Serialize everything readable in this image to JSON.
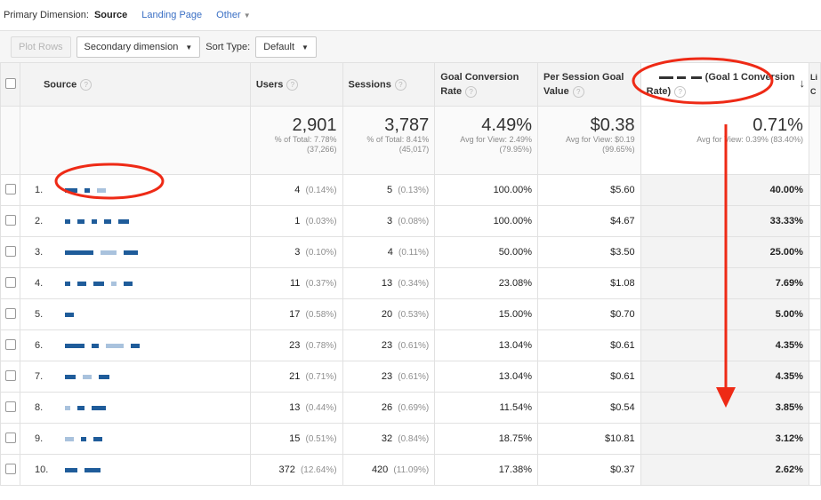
{
  "primary": {
    "label": "Primary Dimension:",
    "active": "Source",
    "options": [
      "Landing Page",
      "Other"
    ]
  },
  "toolbar": {
    "plot_rows": "Plot Rows",
    "secondary": "Secondary dimension",
    "sort_label": "Sort Type:",
    "sort_value": "Default"
  },
  "columns": {
    "source": "Source",
    "users": "Users",
    "sessions": "Sessions",
    "goal_conv": "Goal Conversion Rate",
    "per_session": "Per Session Goal Value",
    "goal1": "(Goal 1 Conversion Rate)",
    "next": "Li C"
  },
  "totals": {
    "users": "2,901",
    "users_sub1": "% of Total: 7.78%",
    "users_sub2": "(37,266)",
    "sessions": "3,787",
    "sessions_sub1": "% of Total: 8.41%",
    "sessions_sub2": "(45,017)",
    "gcr": "4.49%",
    "gcr_sub1": "Avg for View: 2.49%",
    "gcr_sub2": "(79.95%)",
    "psv": "$0.38",
    "psv_sub1": "Avg for View: $0.19",
    "psv_sub2": "(99.65%)",
    "g1": "0.71%",
    "g1_sub": "Avg for View: 0.39% (83.40%)"
  },
  "rows": [
    {
      "idx": "1.",
      "users": "4",
      "users_pct": "(0.14%)",
      "sessions": "5",
      "sessions_pct": "(0.13%)",
      "gcr": "100.00%",
      "psv": "$5.60",
      "g1": "40.00%"
    },
    {
      "idx": "2.",
      "users": "1",
      "users_pct": "(0.03%)",
      "sessions": "3",
      "sessions_pct": "(0.08%)",
      "gcr": "100.00%",
      "psv": "$4.67",
      "g1": "33.33%"
    },
    {
      "idx": "3.",
      "users": "3",
      "users_pct": "(0.10%)",
      "sessions": "4",
      "sessions_pct": "(0.11%)",
      "gcr": "50.00%",
      "psv": "$3.50",
      "g1": "25.00%"
    },
    {
      "idx": "4.",
      "users": "11",
      "users_pct": "(0.37%)",
      "sessions": "13",
      "sessions_pct": "(0.34%)",
      "gcr": "23.08%",
      "psv": "$1.08",
      "g1": "7.69%"
    },
    {
      "idx": "5.",
      "users": "17",
      "users_pct": "(0.58%)",
      "sessions": "20",
      "sessions_pct": "(0.53%)",
      "gcr": "15.00%",
      "psv": "$0.70",
      "g1": "5.00%"
    },
    {
      "idx": "6.",
      "users": "23",
      "users_pct": "(0.78%)",
      "sessions": "23",
      "sessions_pct": "(0.61%)",
      "gcr": "13.04%",
      "psv": "$0.61",
      "g1": "4.35%"
    },
    {
      "idx": "7.",
      "users": "21",
      "users_pct": "(0.71%)",
      "sessions": "23",
      "sessions_pct": "(0.61%)",
      "gcr": "13.04%",
      "psv": "$0.61",
      "g1": "4.35%"
    },
    {
      "idx": "8.",
      "users": "13",
      "users_pct": "(0.44%)",
      "sessions": "26",
      "sessions_pct": "(0.69%)",
      "gcr": "11.54%",
      "psv": "$0.54",
      "g1": "3.85%"
    },
    {
      "idx": "9.",
      "users": "15",
      "users_pct": "(0.51%)",
      "sessions": "32",
      "sessions_pct": "(0.84%)",
      "gcr": "18.75%",
      "psv": "$10.81",
      "g1": "3.12%"
    },
    {
      "idx": "10.",
      "users": "372",
      "users_pct": "(12.64%)",
      "sessions": "420",
      "sessions_pct": "(11.09%)",
      "gcr": "17.38%",
      "psv": "$0.37",
      "g1": "2.62%"
    }
  ],
  "icons": {
    "help": "?",
    "sort_arrow": "↓",
    "dropdown": "▼",
    "other_caret": "▼"
  },
  "colors": {
    "annotation_red": "#ee2a16",
    "link_blue": "#3a6fc4",
    "redaction_blue": "#1f5c9a"
  }
}
